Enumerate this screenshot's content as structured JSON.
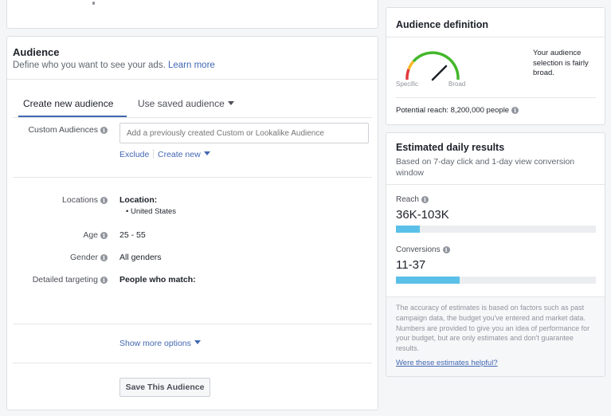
{
  "audience": {
    "title": "Audience",
    "subtitle": "Define who you want to see your ads.",
    "learn_more": "Learn more",
    "tabs": [
      {
        "label": "Create new audience",
        "active": true
      },
      {
        "label": "Use saved audience",
        "active": false
      }
    ],
    "custom_audiences": {
      "label": "Custom Audiences",
      "placeholder": "Add a previously created Custom or Lookalike Audience",
      "exclude": "Exclude",
      "create_new": "Create new"
    },
    "locations": {
      "label": "Locations",
      "heading": "Location:",
      "items": [
        "United States"
      ]
    },
    "age": {
      "label": "Age",
      "value": "25 - 55"
    },
    "gender": {
      "label": "Gender",
      "value": "All genders"
    },
    "detailed_targeting": {
      "label": "Detailed targeting",
      "value": "People who match:"
    },
    "show_more": "Show more options",
    "save_button": "Save This Audience"
  },
  "definition": {
    "title": "Audience definition",
    "description": "Your audience selection is fairly broad.",
    "gauge_specific": "Specific",
    "gauge_broad": "Broad",
    "gauge_level": 0.75,
    "potential_reach_label": "Potential reach:",
    "potential_reach_value": "8,200,000 people"
  },
  "estimates": {
    "title": "Estimated daily results",
    "subtitle": "Based on 7-day click and 1-day view conversion window",
    "reach": {
      "label": "Reach",
      "value": "36K-103K",
      "fill": 0.12
    },
    "conversions": {
      "label": "Conversions",
      "value": "11-37",
      "fill": 0.32
    },
    "disclaimer": "The accuracy of estimates is based on factors such as past campaign data, the budget you've entered and market data. Numbers are provided to give you an idea of performance for your budget, but are only estimates and don't guarantee results.",
    "helpful_link": "Were these estimates helpful?"
  },
  "colors": {
    "link": "#4267b2",
    "bar_fill": "#5bc0e8",
    "gauge_red": "#e0393e",
    "gauge_green": "#42b72a"
  }
}
